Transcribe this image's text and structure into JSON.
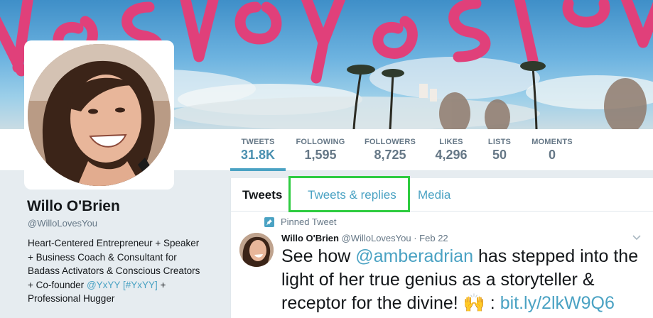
{
  "stats": [
    {
      "label": "TWEETS",
      "value": "31.8K",
      "active": true
    },
    {
      "label": "FOLLOWING",
      "value": "1,595"
    },
    {
      "label": "FOLLOWERS",
      "value": "8,725"
    },
    {
      "label": "LIKES",
      "value": "4,296"
    },
    {
      "label": "LISTS",
      "value": "50"
    },
    {
      "label": "MOMENTS",
      "value": "0"
    }
  ],
  "profile": {
    "name": "Willo O'Brien",
    "handle": "@WilloLovesYou",
    "bio_line1": "Heart-Centered Entrepreneur + Speaker",
    "bio_line2": "+ Business Coach & Consultant for",
    "bio_line3": "Badass Activators & Conscious Creators",
    "bio_line4_prefix": "+ Co-founder ",
    "bio_link_1": "@YxYY",
    "bio_link_2": "[#YxYY]",
    "bio_line4_suffix": " +",
    "bio_line5": "Professional Hugger"
  },
  "tabs": {
    "tweets": "Tweets",
    "replies": "Tweets & replies",
    "media": "Media"
  },
  "tweet": {
    "pinned_label": "Pinned Tweet",
    "author_name": "Willo O'Brien",
    "author_handle": "@WilloLovesYou",
    "date": "· Feb 22",
    "text_1": "See how ",
    "mention": "@amberadrian",
    "text_2": " has stepped into the light of her true genius as a storyteller & receptor for the divine! ",
    "emoji": "🙌",
    "text_3": " : ",
    "link": "bit.ly/2lkW9Q6"
  },
  "colors": {
    "accent": "#4aa2c3",
    "highlight": "#2ecc40",
    "banner_script": "#e0407a"
  },
  "icons": [
    "pin-icon",
    "chevron-down-icon"
  ]
}
